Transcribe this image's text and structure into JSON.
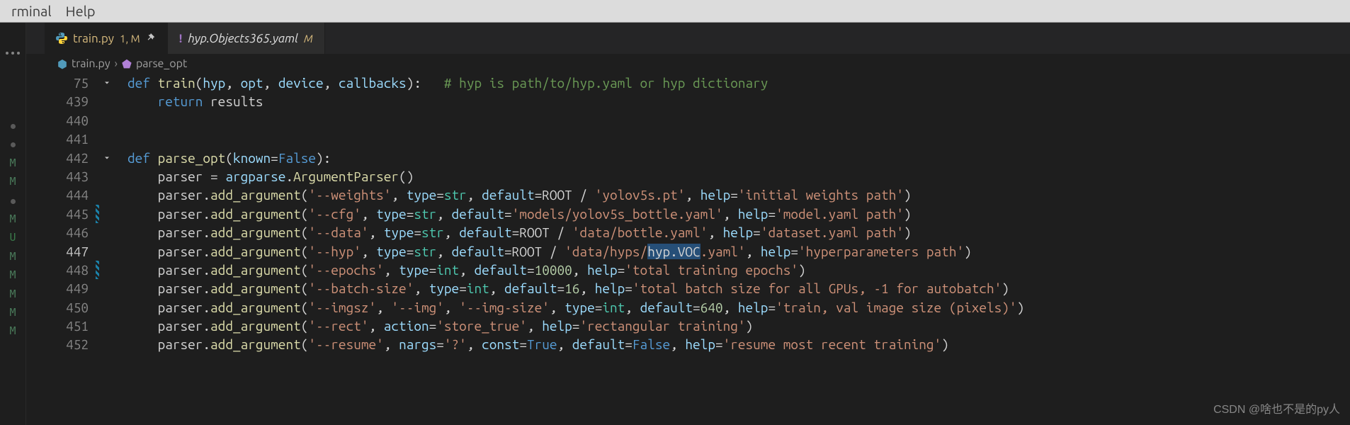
{
  "menubar": {
    "items": [
      "rminal",
      "Help"
    ]
  },
  "tabs": {
    "active": {
      "file": "train.py",
      "mods": "1, M"
    },
    "inactive": {
      "file": "hyp.Objects365.yaml",
      "mods": "M"
    }
  },
  "breadcrumb": {
    "file": "train.py",
    "symbol": "parse_opt"
  },
  "line_numbers": [
    "75",
    "439",
    "440",
    "441",
    "442",
    "443",
    "444",
    "445",
    "446",
    "447",
    "448",
    "449",
    "450",
    "451",
    "452"
  ],
  "current_line_index": 9,
  "diff_marks": [
    "",
    "",
    "",
    "",
    "",
    "",
    "",
    "mod",
    "",
    "",
    "mod",
    "",
    "",
    "",
    ""
  ],
  "fold_marks": [
    "down",
    "",
    "",
    "",
    "down",
    "",
    "",
    "",
    "",
    "",
    "",
    "",
    "",
    "",
    ""
  ],
  "gutter_marks": [
    "dot",
    "dot",
    "",
    "M",
    "M",
    "dot",
    "",
    "",
    "M",
    "U",
    "M",
    "M",
    "M",
    "M",
    "M"
  ],
  "code_lines": [
    [
      [
        "kw",
        "def "
      ],
      [
        "fn",
        "train"
      ],
      [
        "op",
        "("
      ],
      [
        "var",
        "hyp"
      ],
      [
        "op",
        ", "
      ],
      [
        "var",
        "opt"
      ],
      [
        "op",
        ", "
      ],
      [
        "var",
        "device"
      ],
      [
        "op",
        ", "
      ],
      [
        "var",
        "callbacks"
      ],
      [
        "op",
        "):   "
      ],
      [
        "cmt",
        "# hyp is path/to/hyp.yaml or hyp dictionary"
      ]
    ],
    [
      [
        "id",
        "    "
      ],
      [
        "kw",
        "return "
      ],
      [
        "id",
        "results"
      ]
    ],
    [],
    [],
    [
      [
        "kw",
        "def "
      ],
      [
        "fn",
        "parse_opt"
      ],
      [
        "op",
        "("
      ],
      [
        "var",
        "known"
      ],
      [
        "op",
        "="
      ],
      [
        "bool",
        "False"
      ],
      [
        "op",
        "):"
      ]
    ],
    [
      [
        "id",
        "    "
      ],
      [
        "id",
        "parser "
      ],
      [
        "op",
        "= "
      ],
      [
        "var",
        "argparse"
      ],
      [
        "op",
        "."
      ],
      [
        "fn",
        "ArgumentParser"
      ],
      [
        "op",
        "()"
      ]
    ],
    [
      [
        "id",
        "    "
      ],
      [
        "id",
        "parser"
      ],
      [
        "op",
        "."
      ],
      [
        "fn",
        "add_argument"
      ],
      [
        "op",
        "("
      ],
      [
        "str",
        "'--weights'"
      ],
      [
        "op",
        ", "
      ],
      [
        "var",
        "type"
      ],
      [
        "op",
        "="
      ],
      [
        "cls",
        "str"
      ],
      [
        "op",
        ", "
      ],
      [
        "var",
        "default"
      ],
      [
        "op",
        "="
      ],
      [
        "id",
        "ROOT "
      ],
      [
        "op",
        "/ "
      ],
      [
        "str",
        "'yolov5s.pt'"
      ],
      [
        "op",
        ", "
      ],
      [
        "var",
        "help"
      ],
      [
        "op",
        "="
      ],
      [
        "str",
        "'initial weights path'"
      ],
      [
        "op",
        ")"
      ]
    ],
    [
      [
        "id",
        "    "
      ],
      [
        "id",
        "parser"
      ],
      [
        "op",
        "."
      ],
      [
        "fn",
        "add_argument"
      ],
      [
        "op",
        "("
      ],
      [
        "str",
        "'--cfg'"
      ],
      [
        "op",
        ", "
      ],
      [
        "var",
        "type"
      ],
      [
        "op",
        "="
      ],
      [
        "cls",
        "str"
      ],
      [
        "op",
        ", "
      ],
      [
        "var",
        "default"
      ],
      [
        "op",
        "="
      ],
      [
        "str",
        "'models/yolov5s_bottle.yaml'"
      ],
      [
        "op",
        ", "
      ],
      [
        "var",
        "help"
      ],
      [
        "op",
        "="
      ],
      [
        "str",
        "'model.yaml path'"
      ],
      [
        "op",
        ")"
      ]
    ],
    [
      [
        "id",
        "    "
      ],
      [
        "id",
        "parser"
      ],
      [
        "op",
        "."
      ],
      [
        "fn",
        "add_argument"
      ],
      [
        "op",
        "("
      ],
      [
        "str",
        "'--data'"
      ],
      [
        "op",
        ", "
      ],
      [
        "var",
        "type"
      ],
      [
        "op",
        "="
      ],
      [
        "cls",
        "str"
      ],
      [
        "op",
        ", "
      ],
      [
        "var",
        "default"
      ],
      [
        "op",
        "="
      ],
      [
        "id",
        "ROOT "
      ],
      [
        "op",
        "/ "
      ],
      [
        "str",
        "'data/bottle.yaml'"
      ],
      [
        "op",
        ", "
      ],
      [
        "var",
        "help"
      ],
      [
        "op",
        "="
      ],
      [
        "str",
        "'dataset.yaml path'"
      ],
      [
        "op",
        ")"
      ]
    ],
    [
      [
        "id",
        "    "
      ],
      [
        "id",
        "parser"
      ],
      [
        "op",
        "."
      ],
      [
        "fn",
        "add_argument"
      ],
      [
        "op",
        "("
      ],
      [
        "str",
        "'--hyp'"
      ],
      [
        "op",
        ", "
      ],
      [
        "var",
        "type"
      ],
      [
        "op",
        "="
      ],
      [
        "cls",
        "str"
      ],
      [
        "op",
        ", "
      ],
      [
        "var",
        "default"
      ],
      [
        "op",
        "="
      ],
      [
        "id",
        "ROOT "
      ],
      [
        "op",
        "/ "
      ],
      [
        "str",
        "'data/hyps/"
      ],
      [
        "sel",
        "hyp.VOC"
      ],
      [
        "str",
        ".yaml'"
      ],
      [
        "op",
        ", "
      ],
      [
        "var",
        "help"
      ],
      [
        "op",
        "="
      ],
      [
        "str",
        "'hyperparameters path'"
      ],
      [
        "op",
        ")"
      ]
    ],
    [
      [
        "id",
        "    "
      ],
      [
        "id",
        "parser"
      ],
      [
        "op",
        "."
      ],
      [
        "fn",
        "add_argument"
      ],
      [
        "op",
        "("
      ],
      [
        "str",
        "'--epochs'"
      ],
      [
        "op",
        ", "
      ],
      [
        "var",
        "type"
      ],
      [
        "op",
        "="
      ],
      [
        "cls",
        "int"
      ],
      [
        "op",
        ", "
      ],
      [
        "var",
        "default"
      ],
      [
        "op",
        "="
      ],
      [
        "num",
        "10000"
      ],
      [
        "op",
        ", "
      ],
      [
        "var",
        "help"
      ],
      [
        "op",
        "="
      ],
      [
        "str",
        "'total training epochs'"
      ],
      [
        "op",
        ")"
      ]
    ],
    [
      [
        "id",
        "    "
      ],
      [
        "id",
        "parser"
      ],
      [
        "op",
        "."
      ],
      [
        "fn",
        "add_argument"
      ],
      [
        "op",
        "("
      ],
      [
        "str",
        "'--batch-size'"
      ],
      [
        "op",
        ", "
      ],
      [
        "var",
        "type"
      ],
      [
        "op",
        "="
      ],
      [
        "cls",
        "int"
      ],
      [
        "op",
        ", "
      ],
      [
        "var",
        "default"
      ],
      [
        "op",
        "="
      ],
      [
        "num",
        "16"
      ],
      [
        "op",
        ", "
      ],
      [
        "var",
        "help"
      ],
      [
        "op",
        "="
      ],
      [
        "str",
        "'total batch size for all GPUs, -1 for autobatch'"
      ],
      [
        "op",
        ")"
      ]
    ],
    [
      [
        "id",
        "    "
      ],
      [
        "id",
        "parser"
      ],
      [
        "op",
        "."
      ],
      [
        "fn",
        "add_argument"
      ],
      [
        "op",
        "("
      ],
      [
        "str",
        "'--imgsz'"
      ],
      [
        "op",
        ", "
      ],
      [
        "str",
        "'--img'"
      ],
      [
        "op",
        ", "
      ],
      [
        "str",
        "'--img-size'"
      ],
      [
        "op",
        ", "
      ],
      [
        "var",
        "type"
      ],
      [
        "op",
        "="
      ],
      [
        "cls",
        "int"
      ],
      [
        "op",
        ", "
      ],
      [
        "var",
        "default"
      ],
      [
        "op",
        "="
      ],
      [
        "num",
        "640"
      ],
      [
        "op",
        ", "
      ],
      [
        "var",
        "help"
      ],
      [
        "op",
        "="
      ],
      [
        "str",
        "'train, val image size (pixels)'"
      ],
      [
        "op",
        ")"
      ]
    ],
    [
      [
        "id",
        "    "
      ],
      [
        "id",
        "parser"
      ],
      [
        "op",
        "."
      ],
      [
        "fn",
        "add_argument"
      ],
      [
        "op",
        "("
      ],
      [
        "str",
        "'--rect'"
      ],
      [
        "op",
        ", "
      ],
      [
        "var",
        "action"
      ],
      [
        "op",
        "="
      ],
      [
        "str",
        "'store_true'"
      ],
      [
        "op",
        ", "
      ],
      [
        "var",
        "help"
      ],
      [
        "op",
        "="
      ],
      [
        "str",
        "'rectangular training'"
      ],
      [
        "op",
        ")"
      ]
    ],
    [
      [
        "id",
        "    "
      ],
      [
        "id",
        "parser"
      ],
      [
        "op",
        "."
      ],
      [
        "fn",
        "add_argument"
      ],
      [
        "op",
        "("
      ],
      [
        "str",
        "'--resume'"
      ],
      [
        "op",
        ", "
      ],
      [
        "var",
        "nargs"
      ],
      [
        "op",
        "="
      ],
      [
        "str",
        "'?'"
      ],
      [
        "op",
        ", "
      ],
      [
        "var",
        "const"
      ],
      [
        "op",
        "="
      ],
      [
        "bool",
        "True"
      ],
      [
        "op",
        ", "
      ],
      [
        "var",
        "default"
      ],
      [
        "op",
        "="
      ],
      [
        "bool",
        "False"
      ],
      [
        "op",
        ", "
      ],
      [
        "var",
        "help"
      ],
      [
        "op",
        "="
      ],
      [
        "str",
        "'resume most recent training'"
      ],
      [
        "op",
        ")"
      ]
    ]
  ],
  "watermark": "CSDN @啥也不是的py人"
}
